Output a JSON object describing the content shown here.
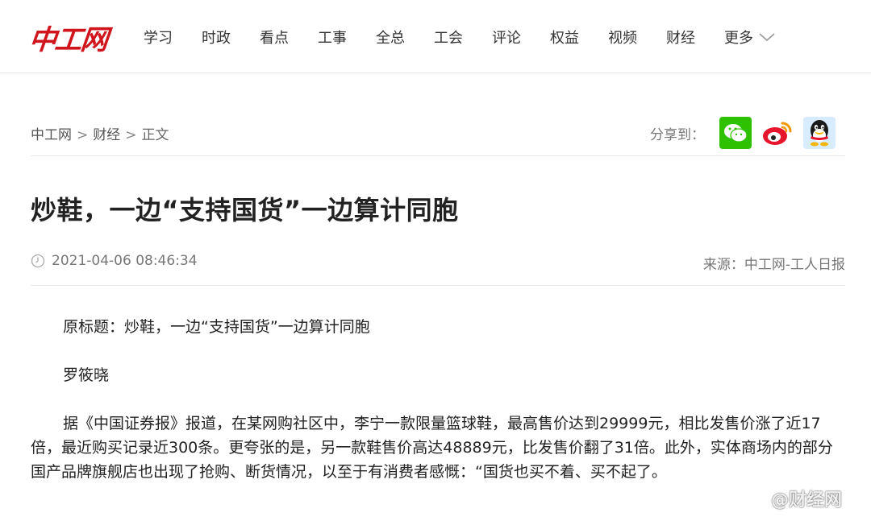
{
  "header": {
    "logo_text": "中工网",
    "nav": [
      "学习",
      "时政",
      "看点",
      "工事",
      "全总",
      "工会",
      "评论",
      "权益",
      "视频",
      "财经"
    ],
    "more_label": "更多"
  },
  "breadcrumb": {
    "home": "中工网",
    "sep": ">",
    "section": "财经",
    "current": "正文"
  },
  "share": {
    "label": "分享到：",
    "icons": [
      "wechat-icon",
      "weibo-icon",
      "qq-icon"
    ]
  },
  "article": {
    "title": "炒鞋，一边“支持国货”一边算计同胞",
    "datetime": "2021-04-06 08:46:34",
    "source": "来源：中工网-工人日报",
    "paragraphs": [
      "原标题：炒鞋，一边“支持国货”一边算计同胞",
      "罗筱晓",
      "据《中国证券报》报道，在某网购社区中，李宁一款限量篮球鞋，最高售价达到29999元，相比发售价涨了近17倍，最近购买记录近300条。更夸张的是，另一款鞋售价高达48889元，比发售价翻了31倍。此外，实体商场内的部分国产品牌旗舰店也出现了抢购、断货情况，以至于有消费者感慨：“国货也买不着、买不起了。"
    ]
  },
  "watermark": {
    "text": "@财经网"
  },
  "colors": {
    "brand_red": "#d0161c",
    "wechat_green": "#2dc100"
  }
}
